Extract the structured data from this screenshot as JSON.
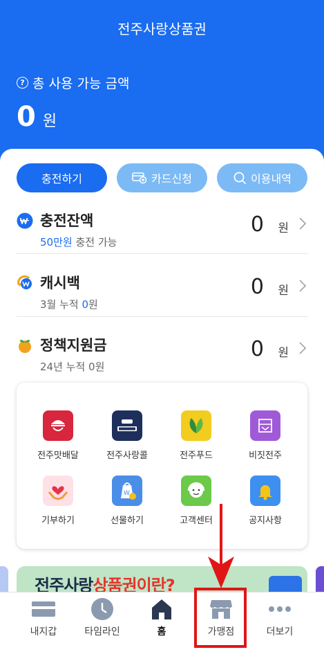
{
  "header": {
    "title": "전주사랑상품권",
    "total_label": "총 사용 가능 금액",
    "total_amount": "0",
    "total_unit": "원"
  },
  "actions": {
    "charge": "충전하기",
    "card_apply": "카드신청",
    "history": "이용내역"
  },
  "balances": [
    {
      "name": "충전잔액",
      "sub_prefix": "",
      "sub_highlight": "50만원",
      "sub_suffix": " 충전 가능",
      "amount": "0",
      "unit": "원",
      "icon": "won-coin-icon"
    },
    {
      "name": "캐시백",
      "sub_prefix": "3월 누적 ",
      "sub_highlight": "0",
      "sub_suffix": "원",
      "amount": "0",
      "unit": "원",
      "icon": "cashback-icon"
    },
    {
      "name": "정책지원금",
      "sub_prefix": "24년 누적 ",
      "sub_highlight": "",
      "sub_suffix": "0원",
      "amount": "0",
      "unit": "원",
      "icon": "sprout-coin-icon"
    }
  ],
  "services": [
    {
      "label": "전주맛배달",
      "icon": "delivery-icon",
      "color": "#d7263d"
    },
    {
      "label": "전주사랑콜",
      "icon": "taxi-call-icon",
      "color": "#1f2f5c"
    },
    {
      "label": "전주푸드",
      "icon": "leaf-icon",
      "color": "#f2cc1f"
    },
    {
      "label": "비짓전주",
      "icon": "visit-icon",
      "color": "#a05ad8"
    },
    {
      "label": "기부하기",
      "icon": "donate-heart-icon",
      "color": "#fde1e6"
    },
    {
      "label": "선물하기",
      "icon": "gift-bag-icon",
      "color": "#4a8ee8"
    },
    {
      "label": "고객센터",
      "icon": "headset-icon",
      "color": "#6cc94a"
    },
    {
      "label": "공지사항",
      "icon": "bell-icon",
      "color": "#3e90f0"
    }
  ],
  "banner": {
    "text_main": "전주사랑",
    "text_accent": "상품권이란?"
  },
  "tabs": [
    {
      "label": "내지갑",
      "icon": "wallet-icon"
    },
    {
      "label": "타임라인",
      "icon": "clock-icon"
    },
    {
      "label": "홈",
      "icon": "home-icon"
    },
    {
      "label": "가맹점",
      "icon": "store-icon"
    },
    {
      "label": "더보기",
      "icon": "more-dots-icon"
    }
  ],
  "colors": {
    "brand": "#1a6cf0",
    "light_brand": "#7cbaf6",
    "highlight": "#e01616"
  }
}
